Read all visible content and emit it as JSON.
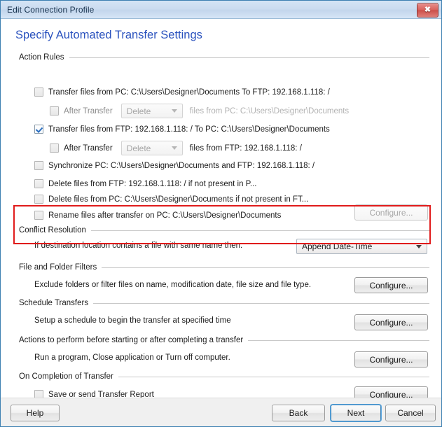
{
  "window": {
    "title": "Edit Connection Profile",
    "close_icon": "close-icon",
    "close_glyph": "✖"
  },
  "page": {
    "heading": "Specify Automated Transfer Settings",
    "heading_color": "#2a52be",
    "highlight_color": "#e01b1b"
  },
  "action_rules": {
    "group_label": "Action Rules",
    "rules": [
      {
        "checked": false,
        "label": "Transfer files from PC: C:\\Users\\Designer\\Documents  To  FTP: 192.168.1.118: /"
      },
      {
        "checked": true,
        "label": "Transfer files from FTP: 192.168.1.118: /  To  PC: C:\\Users\\Designer\\Documents"
      },
      {
        "checked": false,
        "label": "Synchronize PC: C:\\Users\\Designer\\Documents and FTP: 192.168.1.118: /"
      },
      {
        "checked": false,
        "label": "Delete files from FTP: 192.168.1.118: / if not present in P..."
      },
      {
        "checked": false,
        "label": "Delete files from PC: C:\\Users\\Designer\\Documents if not present in FT..."
      },
      {
        "checked": false,
        "label": "Rename files after transfer on PC: C:\\Users\\Designer\\Documents"
      }
    ],
    "after_transfer_1": {
      "checked": false,
      "label": "After Transfer",
      "action": "Delete",
      "trailing": "files from PC: C:\\Users\\Designer\\Documents",
      "enabled": false
    },
    "after_transfer_2": {
      "checked": false,
      "label": "After Transfer",
      "action": "Delete",
      "trailing": "files from FTP: 192.168.1.118: /",
      "enabled": false
    },
    "rename_configure_label": "Configure...",
    "rename_configure_enabled": false
  },
  "conflict_resolution": {
    "group_label": "Conflict Resolution",
    "prompt": "If destination location contains a file with same name then:",
    "selected_option": "Append Date-Time"
  },
  "file_folder_filters": {
    "group_label": "File and Folder Filters",
    "description": "Exclude folders or filter files on name, modification date, file size and file type.",
    "configure_label": "Configure..."
  },
  "schedule_transfers": {
    "group_label": "Schedule Transfers",
    "description": "Setup a schedule to begin the transfer at specified time",
    "configure_label": "Configure..."
  },
  "pre_post_actions": {
    "group_label": "Actions to perform before starting or after completing a transfer",
    "description": "Run a program, Close application or Turn off computer.",
    "configure_label": "Configure..."
  },
  "on_completion": {
    "group_label": "On Completion of Transfer",
    "checkbox_label": "Save or send Transfer Report",
    "checked": false,
    "configure_label": "Configure..."
  },
  "footer": {
    "help_label": "Help",
    "back_label": "Back",
    "next_label": "Next",
    "cancel_label": "Cancel"
  }
}
